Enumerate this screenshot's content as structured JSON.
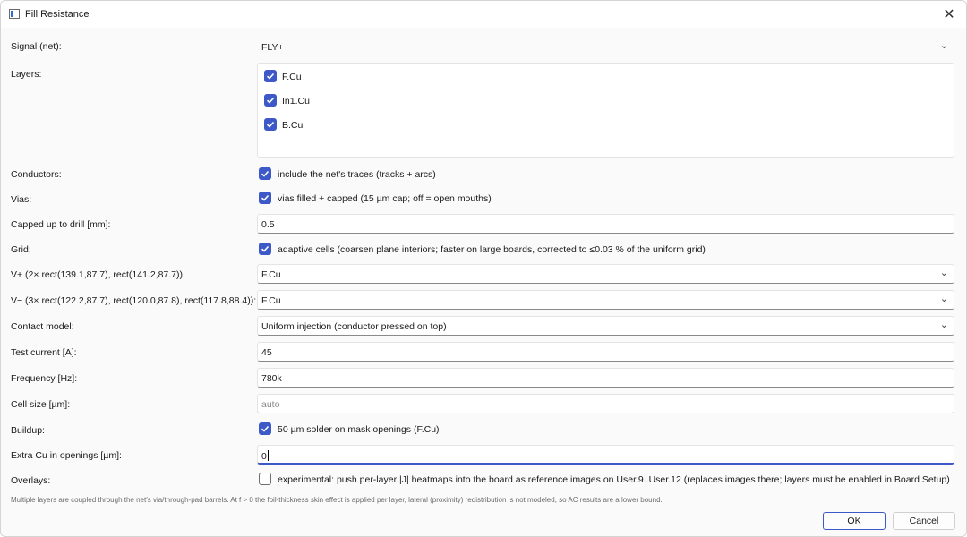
{
  "window": {
    "title": "Fill Resistance"
  },
  "rows": {
    "signal": {
      "label": "Signal (net):",
      "value": "FLY+"
    },
    "layers": {
      "label": "Layers:",
      "items": [
        "F.Cu",
        "In1.Cu",
        "B.Cu"
      ]
    },
    "conductors": {
      "label": "Conductors:",
      "checkbox": "include the net's traces (tracks + arcs)"
    },
    "vias": {
      "label": "Vias:",
      "checkbox": "vias filled + capped (15 µm cap; off = open mouths)"
    },
    "capped": {
      "label": "Capped up to drill [mm]:",
      "value": "0.5"
    },
    "grid": {
      "label": "Grid:",
      "checkbox": "adaptive cells (coarsen plane interiors; faster on large boards, corrected to ≤0.03 % of the uniform grid)"
    },
    "vplus": {
      "label": "V+ (2× rect(139.1,87.7), rect(141.2,87.7)):",
      "value": "F.Cu"
    },
    "vminus": {
      "label": "V− (3× rect(122.2,87.7), rect(120.0,87.8), rect(117.8,88.4)):",
      "value": "F.Cu"
    },
    "contact": {
      "label": "Contact model:",
      "value": "Uniform injection (conductor pressed on top)"
    },
    "current": {
      "label": "Test current [A]:",
      "value": "45"
    },
    "frequency": {
      "label": "Frequency [Hz]:",
      "value": "780k"
    },
    "cellsize": {
      "label": "Cell size [µm]:",
      "placeholder": "auto"
    },
    "buildup": {
      "label": "Buildup:",
      "checkbox": "50 µm solder on mask openings (F.Cu)"
    },
    "extracu": {
      "label": "Extra Cu in openings [µm]:",
      "value": "0"
    },
    "overlays": {
      "label": "Overlays:",
      "checkbox": "experimental: push per-layer |J| heatmaps into the board as reference images on User.9..User.12 (replaces images there; layers must be enabled in Board Setup)"
    }
  },
  "note": "Multiple layers are coupled through the net's via/through-pad barrels. At f > 0 the foil-thickness skin effect is applied per layer, lateral (proximity) redistribution is not modeled, so AC results are a lower bound.",
  "buttons": {
    "ok": "OK",
    "cancel": "Cancel"
  },
  "colors": {
    "accent": "#3d59c8"
  }
}
